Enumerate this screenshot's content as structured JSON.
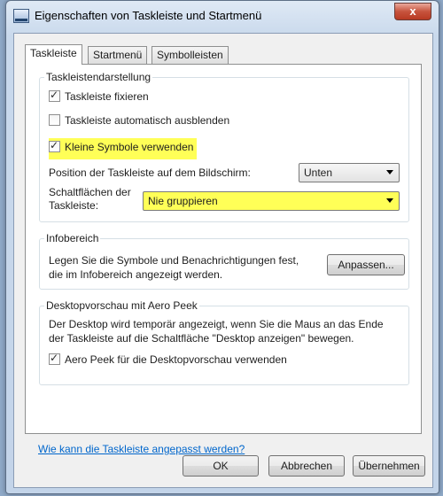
{
  "window": {
    "title": "Eigenschaften von Taskleiste und Startmenü",
    "close_glyph": "x"
  },
  "tabs": [
    {
      "label": "Taskleiste",
      "active": true
    },
    {
      "label": "Startmenü",
      "active": false
    },
    {
      "label": "Symbolleisten",
      "active": false
    }
  ],
  "appearance": {
    "title": "Taskleistendarstellung",
    "lock": {
      "label": "Taskleiste fixieren",
      "checked": true
    },
    "autohide": {
      "label": "Taskleiste automatisch ausblenden",
      "checked": false
    },
    "small_icons": {
      "label": "Kleine Symbole verwenden",
      "checked": true
    },
    "position_label": "Position der Taskleiste auf dem Bildschirm:",
    "position_value": "Unten",
    "buttons_label_line1": "Schaltflächen der",
    "buttons_label_line2": "Taskleiste:",
    "buttons_value": "Nie gruppieren"
  },
  "notification": {
    "title": "Infobereich",
    "text_line1": "Legen Sie die Symbole und Benachrichtigungen fest,",
    "text_line2": "die im Infobereich angezeigt werden.",
    "customize_label": "Anpassen..."
  },
  "peek": {
    "title": "Desktopvorschau mit Aero Peek",
    "text_line1": "Der Desktop wird temporär angezeigt, wenn Sie die Maus an das Ende",
    "text_line2": "der Taskleiste auf die Schaltfläche \"Desktop anzeigen\" bewegen.",
    "use_peek": {
      "label": "Aero Peek für die Desktopvorschau verwenden",
      "checked": true
    }
  },
  "help_link": "Wie kann die Taskleiste angepasst werden?",
  "footer": {
    "ok": "OK",
    "cancel": "Abbrechen",
    "apply": "Übernehmen"
  },
  "colors": {
    "highlight": "#ffff57",
    "link": "#0066cc"
  }
}
